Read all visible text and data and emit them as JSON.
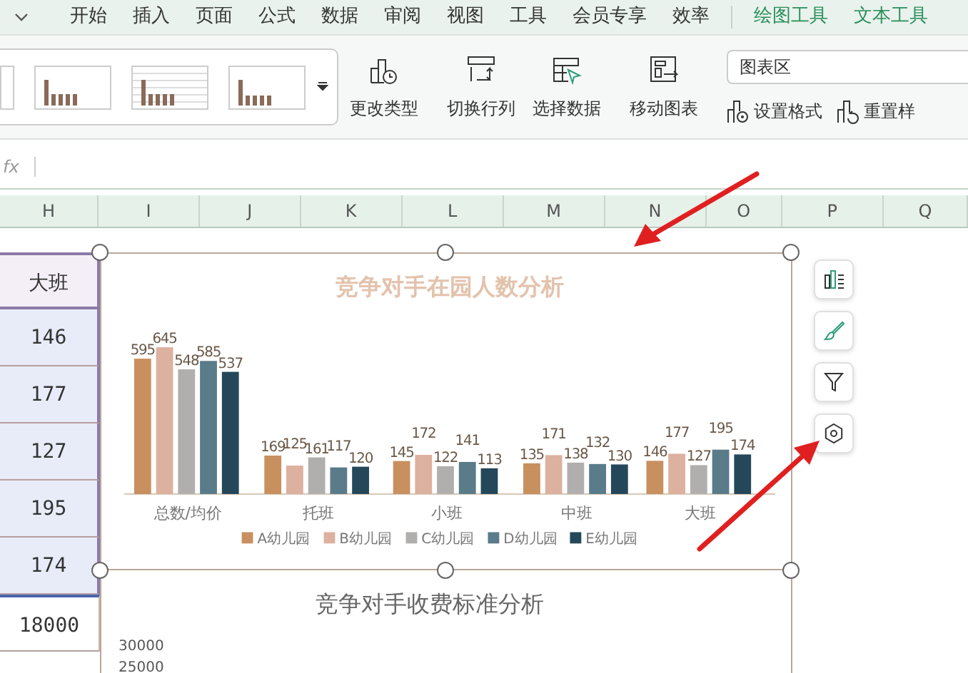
{
  "menu_tabs": [
    {
      "label": "开始",
      "selected": false,
      "contextual": false
    },
    {
      "label": "插入",
      "selected": false,
      "contextual": false
    },
    {
      "label": "页面",
      "selected": false,
      "contextual": false
    },
    {
      "label": "公式",
      "selected": false,
      "contextual": false
    },
    {
      "label": "数据",
      "selected": false,
      "contextual": false
    },
    {
      "label": "审阅",
      "selected": false,
      "contextual": false
    },
    {
      "label": "视图",
      "selected": false,
      "contextual": false
    },
    {
      "label": "工具",
      "selected": false,
      "contextual": false
    },
    {
      "label": "会员专享",
      "selected": false,
      "contextual": false
    },
    {
      "label": "效率",
      "selected": false,
      "contextual": false
    },
    {
      "label": "绘图工具",
      "selected": false,
      "contextual": true
    },
    {
      "label": "文本工具",
      "selected": false,
      "contextual": true
    }
  ],
  "ribbon": {
    "buttons": [
      {
        "kind": "change-type",
        "label": "更改类型"
      },
      {
        "kind": "switch",
        "label": "切换行列"
      },
      {
        "kind": "select",
        "label": "选择数据"
      },
      {
        "kind": "move",
        "label": "移动图表"
      }
    ],
    "element_dropdown": {
      "value": "图表区"
    },
    "small_buttons": [
      {
        "kind": "format",
        "label": "设置格式"
      },
      {
        "kind": "reset",
        "label": "重置样"
      }
    ]
  },
  "formula_bar": {
    "label": "fx"
  },
  "columns": [
    "H",
    "I",
    "J",
    "K",
    "L",
    "M",
    "N",
    "O",
    "P",
    "Q"
  ],
  "column_h_cells": [
    {
      "text": "大班",
      "kind": "header"
    },
    {
      "text": "146",
      "kind": "data"
    },
    {
      "text": "177",
      "kind": "data"
    },
    {
      "text": "127",
      "kind": "data"
    },
    {
      "text": "195",
      "kind": "data"
    },
    {
      "text": "174",
      "kind": "data"
    },
    {
      "text": "18000",
      "kind": "plain"
    }
  ],
  "chart_1": {
    "chart_data": {
      "type": "bar",
      "title": "竞争对手在园人数分析",
      "categories": [
        "总数/均价",
        "托班",
        "小班",
        "中班",
        "大班"
      ],
      "series": [
        {
          "name": "A幼儿园",
          "color": "#c8905f",
          "values": [
            595,
            169,
            145,
            135,
            146
          ]
        },
        {
          "name": "B幼儿园",
          "color": "#dcb19f",
          "values": [
            645,
            125,
            172,
            171,
            177
          ]
        },
        {
          "name": "C幼儿园",
          "color": "#b1afad",
          "values": [
            548,
            161,
            122,
            138,
            127
          ]
        },
        {
          "name": "D幼儿园",
          "color": "#5a7b89",
          "values": [
            585,
            117,
            141,
            132,
            195
          ]
        },
        {
          "name": "E幼儿园",
          "color": "#24485a",
          "values": [
            537,
            120,
            113,
            130,
            174
          ]
        }
      ],
      "data_labels": true,
      "legend": "bottom"
    }
  },
  "chart_2": {
    "title": "竞争对手收费标准分析",
    "y_tick_labels": [
      "30000",
      "25000"
    ]
  }
}
